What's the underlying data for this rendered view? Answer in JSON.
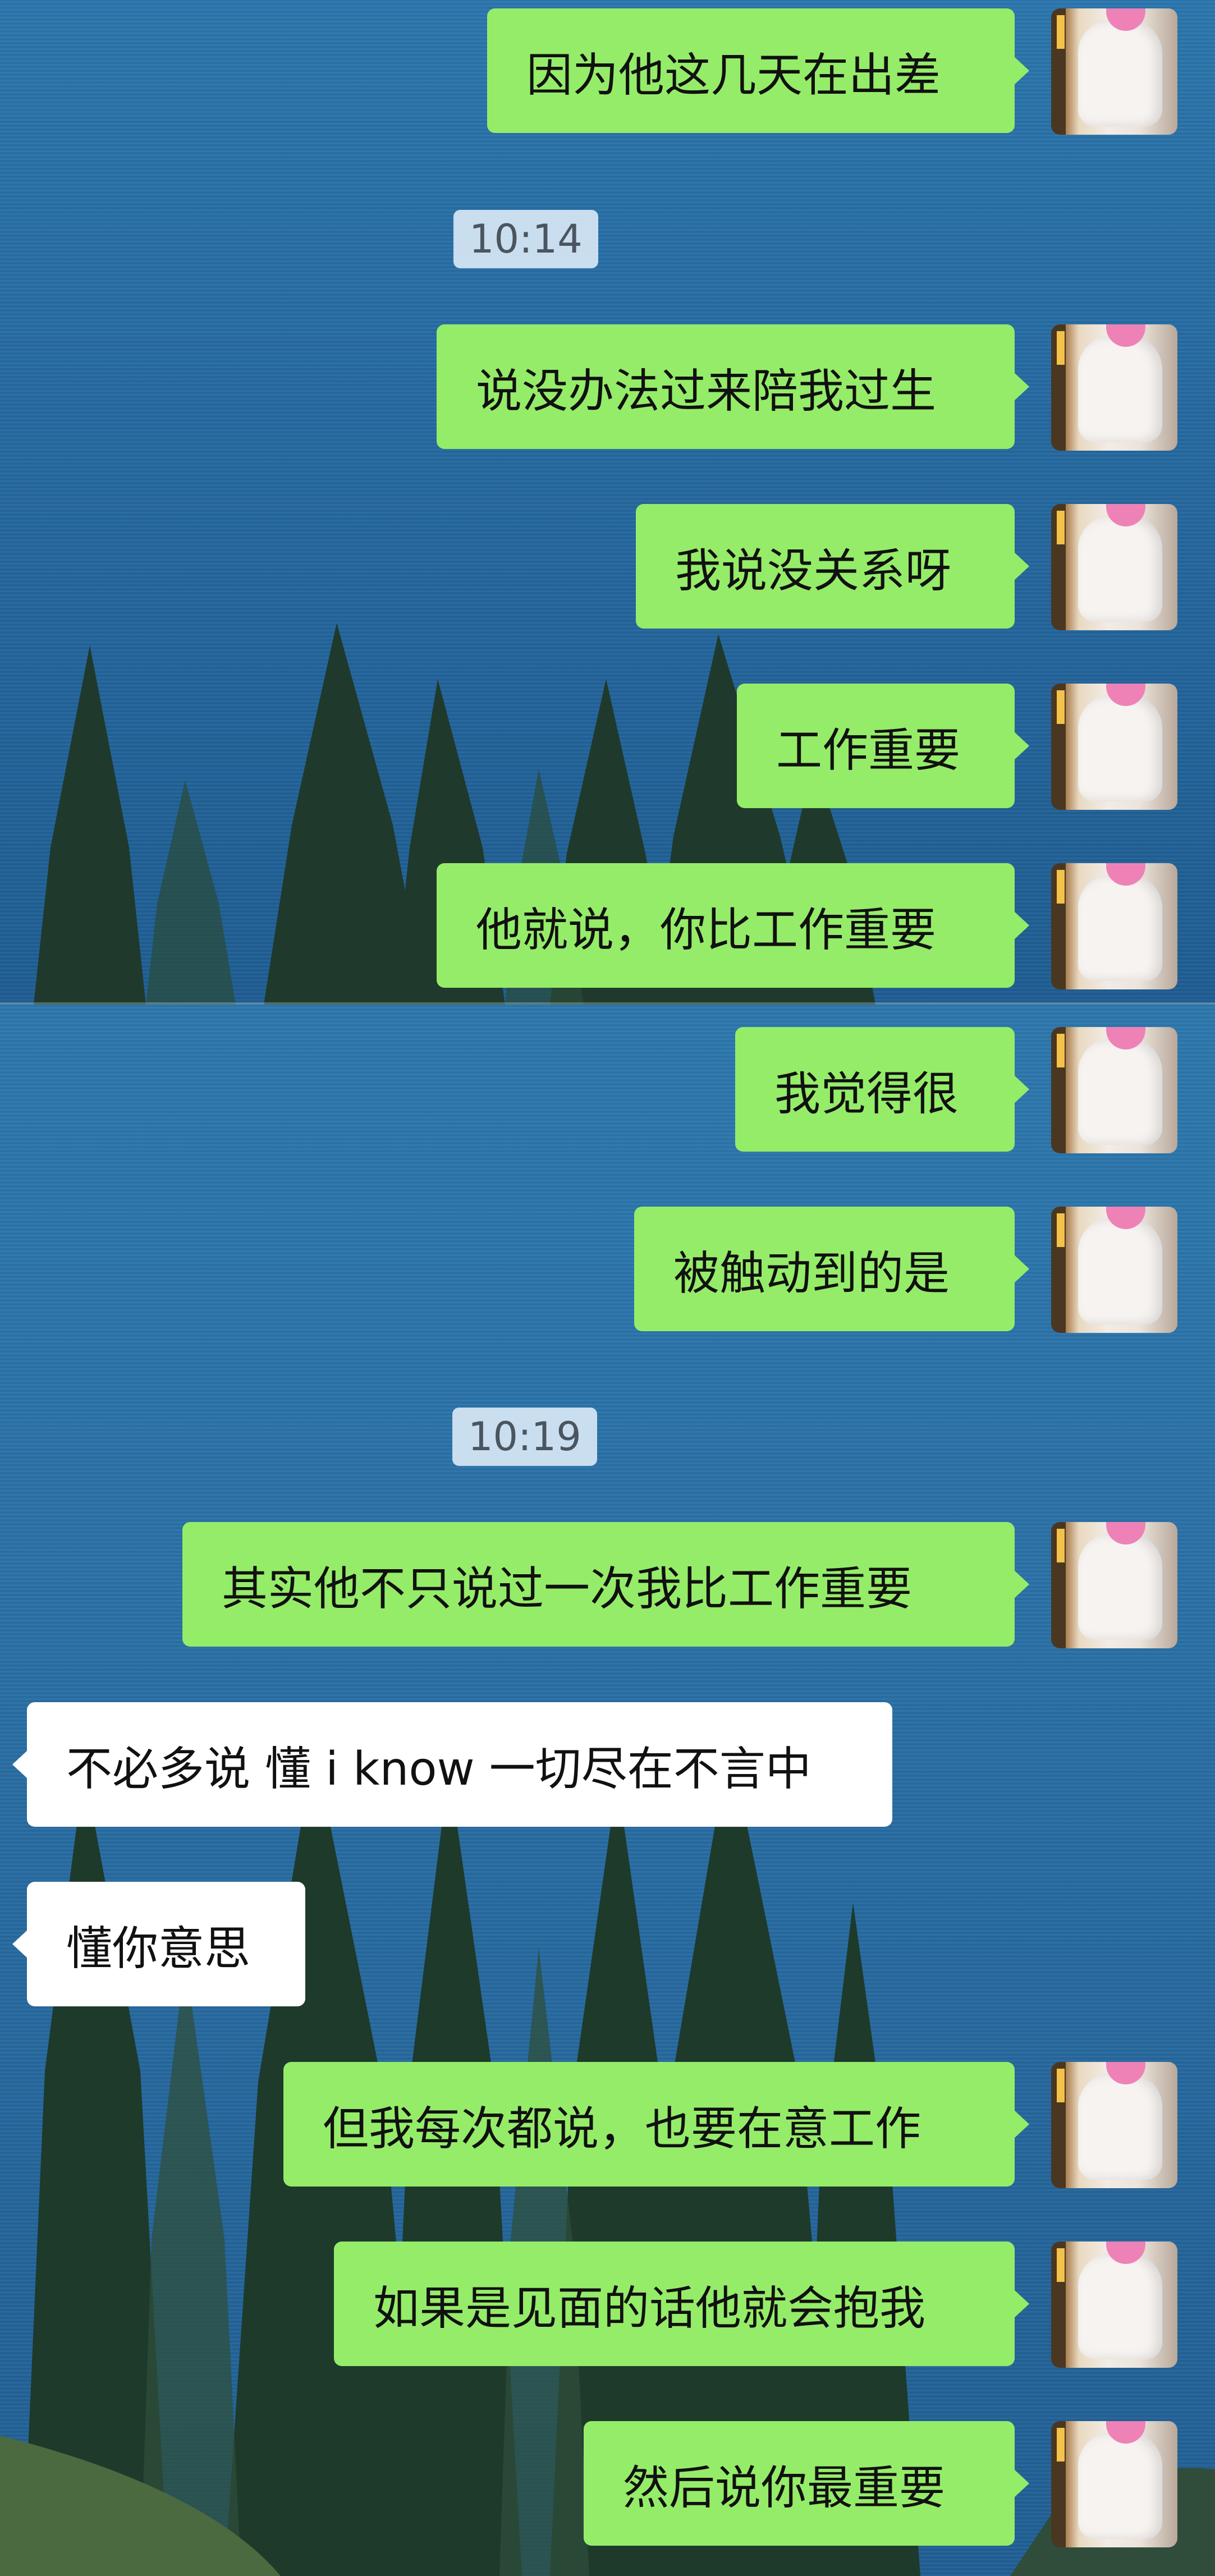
{
  "chat": {
    "messages": [
      {
        "id": "m1",
        "side": "me",
        "text": "因为他这几天在出差"
      },
      {
        "id": "t1",
        "type": "time",
        "text": "10:14"
      },
      {
        "id": "m2",
        "side": "me",
        "text": "说没办法过来陪我过生"
      },
      {
        "id": "m3",
        "side": "me",
        "text": "我说没关系呀"
      },
      {
        "id": "m4",
        "side": "me",
        "text": "工作重要"
      },
      {
        "id": "m5",
        "side": "me",
        "text": "他就说，你比工作重要"
      },
      {
        "id": "m6",
        "side": "me",
        "text": "我觉得很"
      },
      {
        "id": "m7",
        "side": "me",
        "text": "被触动到的是"
      },
      {
        "id": "t2",
        "type": "time",
        "text": "10:19"
      },
      {
        "id": "m8",
        "side": "me",
        "text": "其实他不只说过一次我比工作重要"
      },
      {
        "id": "m9",
        "side": "other",
        "text": "不必多说 懂 i know 一切尽在不言中"
      },
      {
        "id": "m10",
        "side": "other",
        "text": "懂你意思"
      },
      {
        "id": "m11",
        "side": "me",
        "text": "但我每次都说，也要在意工作"
      },
      {
        "id": "m12",
        "side": "me",
        "text": "如果是见面的话他就会抱我"
      },
      {
        "id": "m13",
        "side": "me",
        "text": "然后说你最重要"
      }
    ]
  },
  "colors": {
    "my_bubble": "#95ec69",
    "other_bubble": "#ffffff",
    "timestamp_bg": "#d7e7f4"
  },
  "icons": {
    "avatar": "user-avatar-photo",
    "background": "lake-and-pine-trees-wallpaper"
  }
}
